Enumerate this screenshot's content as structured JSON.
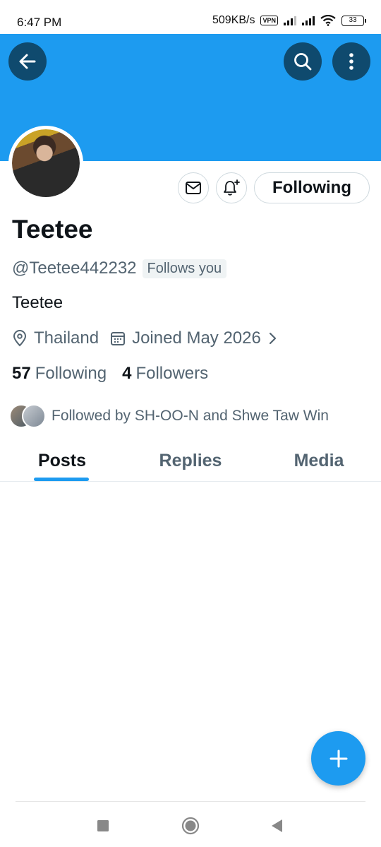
{
  "status_bar": {
    "time": "6:47 PM",
    "speed": "509KB/s",
    "vpn": "VPN",
    "battery": "33"
  },
  "header": {
    "back_icon": "arrow-left-icon",
    "search_icon": "search-icon",
    "more_icon": "more-vertical-icon",
    "banner_color": "#1d9bf0"
  },
  "profile": {
    "name": "Teetee",
    "handle": "@Teetee442232",
    "follows_you": "Follows you",
    "bio": "Teetee",
    "location": "Thailand",
    "joined": "Joined May 2026",
    "following_count": "57",
    "following_label": "Following",
    "followers_count": "4",
    "followers_label": "Followers",
    "followed_by": "Followed by SH-OO-N and Shwe Taw Win"
  },
  "actions": {
    "message_icon": "envelope-icon",
    "notify_icon": "bell-plus-icon",
    "following_button": "Following"
  },
  "tabs": [
    {
      "label": "Posts",
      "active": true
    },
    {
      "label": "Replies",
      "active": false
    },
    {
      "label": "Media",
      "active": false
    }
  ],
  "fab": {
    "icon": "plus-icon"
  },
  "accent_color": "#1d9bf0"
}
